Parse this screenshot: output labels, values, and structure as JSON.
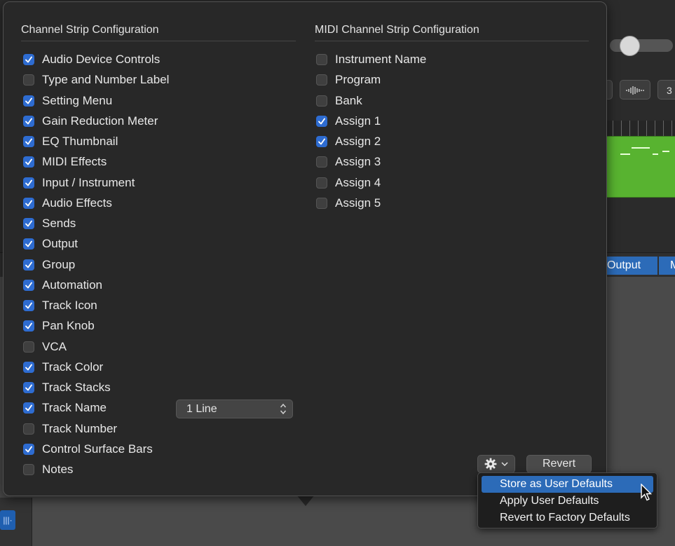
{
  "background": {
    "output_label": "Output",
    "output_label_2": "M",
    "partial_number": "3"
  },
  "popover": {
    "left_title": "Channel Strip Configuration",
    "right_title": "MIDI Channel Strip Configuration",
    "channel_strip_items": [
      {
        "label": "Audio Device Controls",
        "checked": true
      },
      {
        "label": "Type and Number Label",
        "checked": false
      },
      {
        "label": "Setting Menu",
        "checked": true
      },
      {
        "label": "Gain Reduction Meter",
        "checked": true
      },
      {
        "label": "EQ Thumbnail",
        "checked": true
      },
      {
        "label": "MIDI Effects",
        "checked": true
      },
      {
        "label": "Input / Instrument",
        "checked": true
      },
      {
        "label": "Audio Effects",
        "checked": true
      },
      {
        "label": "Sends",
        "checked": true
      },
      {
        "label": "Output",
        "checked": true
      },
      {
        "label": "Group",
        "checked": true
      },
      {
        "label": "Automation",
        "checked": true
      },
      {
        "label": "Track Icon",
        "checked": true
      },
      {
        "label": "Pan Knob",
        "checked": true
      },
      {
        "label": "VCA",
        "checked": false
      },
      {
        "label": "Track Color",
        "checked": true
      },
      {
        "label": "Track Stacks",
        "checked": true
      },
      {
        "label": "Track Name",
        "checked": true
      },
      {
        "label": "Track Number",
        "checked": false
      },
      {
        "label": "Control Surface Bars",
        "checked": true
      },
      {
        "label": "Notes",
        "checked": false
      }
    ],
    "midi_items": [
      {
        "label": "Instrument Name",
        "checked": false
      },
      {
        "label": "Program",
        "checked": false
      },
      {
        "label": "Bank",
        "checked": false
      },
      {
        "label": "Assign 1",
        "checked": true
      },
      {
        "label": "Assign 2",
        "checked": true
      },
      {
        "label": "Assign 3",
        "checked": false
      },
      {
        "label": "Assign 4",
        "checked": false
      },
      {
        "label": "Assign 5",
        "checked": false
      }
    ],
    "track_name_lines": "1 Line",
    "revert_label": "Revert",
    "gear_icon": "gear-icon",
    "accent_color": "#2e6cd1"
  },
  "menu": {
    "items": [
      {
        "label": "Store as User Defaults",
        "highlighted": true
      },
      {
        "label": "Apply User Defaults",
        "highlighted": false
      },
      {
        "label": "Revert to Factory Defaults",
        "highlighted": false
      }
    ]
  }
}
